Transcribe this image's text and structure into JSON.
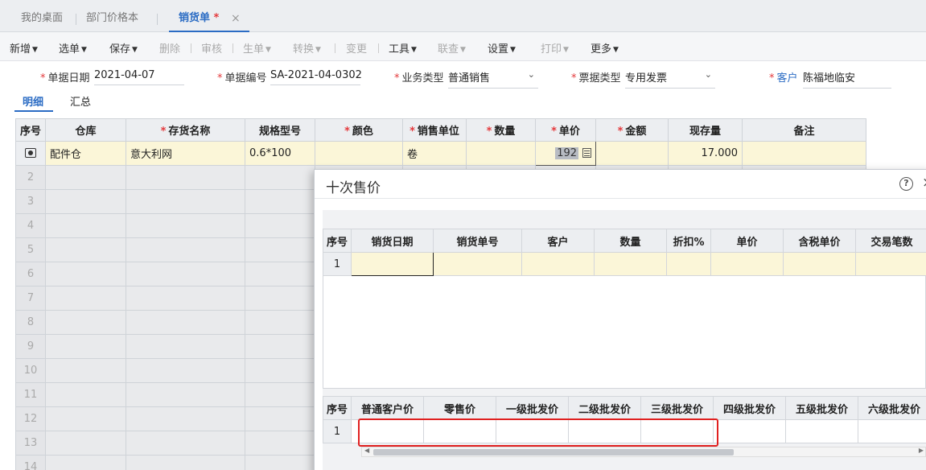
{
  "tabs": [
    {
      "label": "我的桌面"
    },
    {
      "label": "部门价格本"
    },
    {
      "label": "销货单",
      "modified": "*"
    }
  ],
  "tab_close": "×",
  "toolbar": {
    "items": [
      {
        "label": "新增",
        "dropdown": true,
        "enabled": true
      },
      {
        "label": "选单",
        "dropdown": true,
        "enabled": true
      },
      {
        "label": "保存",
        "dropdown": true,
        "enabled": true
      },
      {
        "label": "删除",
        "dropdown": false,
        "enabled": false
      },
      {
        "label": "审核",
        "dropdown": false,
        "enabled": false
      },
      {
        "label": "生单",
        "dropdown": true,
        "enabled": false
      },
      {
        "label": "转换",
        "dropdown": true,
        "enabled": false
      },
      {
        "label": "变更",
        "dropdown": false,
        "enabled": false
      },
      {
        "label": "工具",
        "dropdown": true,
        "enabled": true
      },
      {
        "label": "联查",
        "dropdown": true,
        "enabled": false
      },
      {
        "label": "设置",
        "dropdown": true,
        "enabled": true
      },
      {
        "label": "打印",
        "dropdown": true,
        "enabled": false
      },
      {
        "label": "更多",
        "dropdown": true,
        "enabled": true
      }
    ]
  },
  "form": {
    "date_label": "单据日期",
    "date_value": "2021-04-07",
    "code_label": "单据编号",
    "code_value": "SA-2021-04-0302",
    "biz_label": "业务类型",
    "biz_value": "普通销售",
    "invoice_label": "票据类型",
    "invoice_value": "专用发票",
    "customer_label": "客户",
    "customer_value": "陈福地临安"
  },
  "subtabs": {
    "detail": "明细",
    "summary": "汇总"
  },
  "main_grid": {
    "headers": [
      "序号",
      "仓库",
      "存货名称",
      "规格型号",
      "颜色",
      "销售单位",
      "数量",
      "单价",
      "金额",
      "现存量",
      "备注"
    ],
    "required": [
      false,
      false,
      true,
      false,
      true,
      true,
      true,
      true,
      true,
      false,
      false
    ],
    "row1": {
      "warehouse": "配件仓",
      "item": "意大利网",
      "spec": "0.6*100",
      "color": "",
      "unit": "卷",
      "qty": "",
      "price": "192",
      "amount": "",
      "stock": "17.000",
      "note": ""
    },
    "row_numbers": [
      "2",
      "3",
      "4",
      "5",
      "6",
      "7",
      "8",
      "9",
      "10",
      "11",
      "12",
      "13",
      "14"
    ]
  },
  "dialog": {
    "title": "十次售价",
    "help": "?",
    "close": "×",
    "history_headers": [
      "序号",
      "销货日期",
      "销货单号",
      "客户",
      "数量",
      "折扣%",
      "单价",
      "含税单价",
      "交易笔数"
    ],
    "history_row_no": "1",
    "price_headers": [
      "序号",
      "普通客户价",
      "零售价",
      "一级批发价",
      "二级批发价",
      "三级批发价",
      "四级批发价",
      "五级批发价",
      "六级批发价"
    ],
    "price_row_no": "1"
  },
  "colors": {
    "accent": "#2b6cc4",
    "required": "#e4393c",
    "highlight_row": "#fbf6d8",
    "annotation_box": "#e02020"
  },
  "icons": [
    "settings-icon",
    "calculator-icon",
    "help-icon",
    "close-icon",
    "chevron-down-icon"
  ]
}
